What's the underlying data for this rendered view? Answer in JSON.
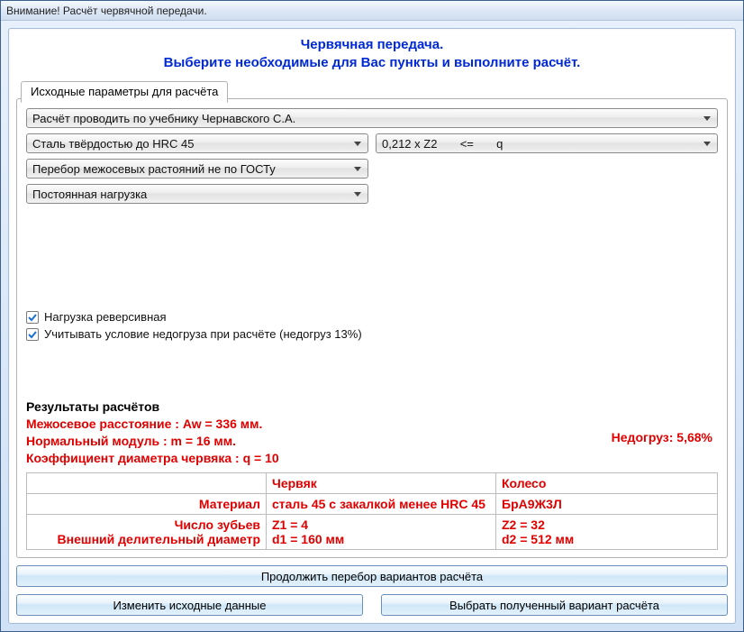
{
  "window": {
    "title": "Внимание! Расчёт червячной передачи."
  },
  "header": {
    "line1": "Червячная передача.",
    "line2": "Выберите необходимые для Вас пункты и выполните расчёт."
  },
  "tabs": {
    "active": "Исходные параметры для расчёта"
  },
  "selects": {
    "method": "Расчёт проводить по учебнику Чернавского С.А.",
    "steel": "Сталь твёрдостью до HRC 45",
    "zcond": "0,212 x Z2       <=       q",
    "axial": "Перебор межосевых растояний не по ГОСТу",
    "load": "Постоянная нагрузка"
  },
  "checkboxes": {
    "reversive_label": "Нагрузка реверсивная",
    "underload_label": "Учитывать условие недогруза при расчёте (недогруз 13%)"
  },
  "results": {
    "title": "Результаты расчётов",
    "summary": {
      "aw": "Межосевое расстояние :  Aw = 336 мм.",
      "m": "Нормальный модуль :  m = 16 мм.",
      "q": "Коэффициент диаметра червяка :  q = 10"
    },
    "underload": "Недогруз: 5,68%",
    "table": {
      "col1": "Червяк",
      "col2": "Колесо",
      "rows": {
        "material": {
          "label": "Материал",
          "worm": "сталь 45 с закалкой менее HRC 45",
          "wheel": "БрА9Ж3Л"
        },
        "teeth": {
          "label": "Число зубьев",
          "worm": "Z1 = 4",
          "wheel": "Z2 = 32"
        },
        "diameter": {
          "label": "Внешний делительный диаметр",
          "worm": "d1 = 160 мм",
          "wheel": "d2 = 512 мм"
        }
      }
    }
  },
  "buttons": {
    "continue": "Продолжить перебор вариантов расчёта",
    "change": "Изменить исходные данные",
    "choose": "Выбрать полученный вариант расчёта"
  }
}
